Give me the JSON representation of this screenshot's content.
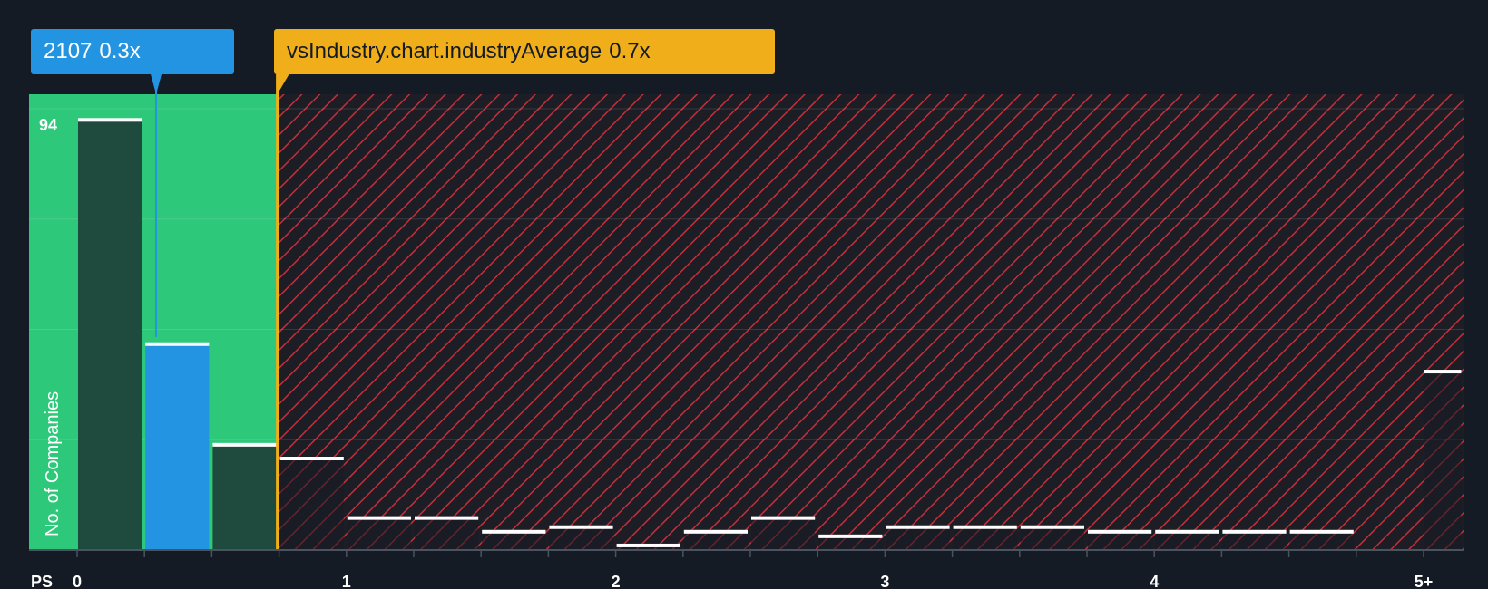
{
  "company": {
    "ticker": "2107",
    "ps_label": "0.3x",
    "ps": 0.3
  },
  "industry": {
    "label": "vsIndustry.chart.industryAverage",
    "ps_label": "0.7x",
    "ps": 0.75
  },
  "colors": {
    "background": "#151b24",
    "undervalued_zone": "#2ec87b",
    "overvalued_hatch": "#c62e38",
    "company_bar": "#2394e2",
    "company_callout": "#2394e2",
    "industry_callout": "#f0ae1b",
    "bar_cap": "#ffffff"
  },
  "chart_data": {
    "type": "bar",
    "title": "",
    "xlabel": "PS",
    "ylabel": "No. of Companies",
    "x_ticks": [
      "0",
      "1",
      "2",
      "3",
      "4",
      "5+"
    ],
    "xlim": [
      0,
      5.15
    ],
    "ylim": [
      0,
      100
    ],
    "y_top_label": "94",
    "grid": true,
    "bins": [
      {
        "x0": 0.0,
        "x1": 0.25,
        "count": 94
      },
      {
        "x0": 0.25,
        "x1": 0.5,
        "count": 45
      },
      {
        "x0": 0.5,
        "x1": 0.75,
        "count": 23
      },
      {
        "x0": 0.75,
        "x1": 1.0,
        "count": 20
      },
      {
        "x0": 1.0,
        "x1": 1.25,
        "count": 7
      },
      {
        "x0": 1.25,
        "x1": 1.5,
        "count": 7
      },
      {
        "x0": 1.5,
        "x1": 1.75,
        "count": 4
      },
      {
        "x0": 1.75,
        "x1": 2.0,
        "count": 5
      },
      {
        "x0": 2.0,
        "x1": 2.25,
        "count": 1
      },
      {
        "x0": 2.25,
        "x1": 2.5,
        "count": 4
      },
      {
        "x0": 2.5,
        "x1": 2.75,
        "count": 7
      },
      {
        "x0": 2.75,
        "x1": 3.0,
        "count": 3
      },
      {
        "x0": 3.0,
        "x1": 3.25,
        "count": 5
      },
      {
        "x0": 3.25,
        "x1": 3.5,
        "count": 5
      },
      {
        "x0": 3.5,
        "x1": 3.75,
        "count": 5
      },
      {
        "x0": 3.75,
        "x1": 4.0,
        "count": 4
      },
      {
        "x0": 4.0,
        "x1": 4.25,
        "count": 4
      },
      {
        "x0": 4.25,
        "x1": 4.5,
        "count": 4
      },
      {
        "x0": 4.5,
        "x1": 4.75,
        "count": 4
      },
      {
        "x0": 5.0,
        "x1": 5.15,
        "count": 39
      }
    ]
  }
}
